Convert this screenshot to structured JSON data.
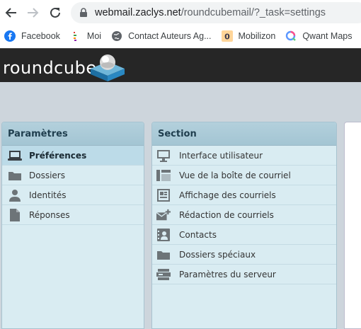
{
  "browser": {
    "url_host": "webmail.zaclys.net",
    "url_path": "/roundcubemail/?_task=settings",
    "bookmarks": [
      {
        "label": "Facebook",
        "icon": "facebook-icon"
      },
      {
        "label": "Moi",
        "icon": "bookmark-icon"
      },
      {
        "label": "Contact Auteurs Ag...",
        "icon": "globe-icon"
      },
      {
        "label": "Mobilizon",
        "icon": "mobilizon-icon"
      },
      {
        "label": "Qwant Maps",
        "icon": "qwant-icon"
      }
    ]
  },
  "app": {
    "logo_text": "roundcube"
  },
  "settings_panel": {
    "title": "Paramètres",
    "items": [
      {
        "label": "Préférences",
        "icon": "monitor-icon",
        "selected": true
      },
      {
        "label": "Dossiers",
        "icon": "folder-icon",
        "selected": false
      },
      {
        "label": "Identités",
        "icon": "person-icon",
        "selected": false
      },
      {
        "label": "Réponses",
        "icon": "document-icon",
        "selected": false
      }
    ]
  },
  "section_panel": {
    "title": "Section",
    "items": [
      {
        "label": "Interface utilisateur",
        "icon": "monitor-icon"
      },
      {
        "label": "Vue de la boîte de courriel",
        "icon": "layout-icon"
      },
      {
        "label": "Affichage des courriels",
        "icon": "message-view-icon"
      },
      {
        "label": "Rédaction de courriels",
        "icon": "compose-icon"
      },
      {
        "label": "Contacts",
        "icon": "contact-card-icon"
      },
      {
        "label": "Dossiers spéciaux",
        "icon": "folder-icon"
      },
      {
        "label": "Paramètres du serveur",
        "icon": "server-icon"
      }
    ]
  },
  "colors": {
    "header_bg": "#262626",
    "content_bg": "#cdd5dc",
    "panel_bg": "#d9ecf2",
    "panel_head": "#a3c5d3",
    "selected_bg": "#bcdbe8"
  }
}
